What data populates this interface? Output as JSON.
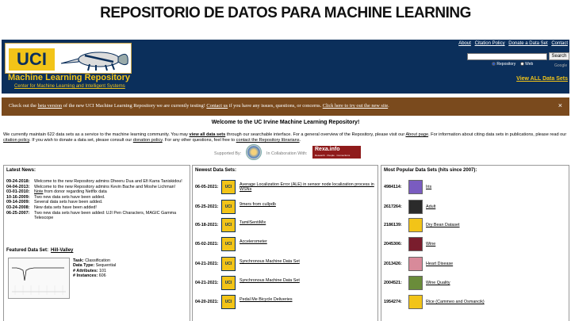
{
  "slide_title": "REPOSITORIO DE DATOS PARA MACHINE LEARNING",
  "header": {
    "logo_text": "UCI",
    "repo_name": "Machine Learning Repository",
    "repo_sub": "Center for Machine Learning and Intelligent Systems",
    "top_links": [
      "About",
      "Citation Policy",
      "Donate a Data Set",
      "Contact"
    ],
    "search": {
      "button_label": "Search",
      "value": "",
      "options": [
        "Repository",
        "Web"
      ],
      "selected": "Repository",
      "google_label": "Google"
    },
    "view_all_label": "View ALL Data Sets"
  },
  "beta_banner": {
    "text_1": "Check out the ",
    "link_1": "beta version",
    "text_2": " of the new UCI Machine Learning Repository we are currently testing! ",
    "link_2": "Contact us",
    "text_3": " if you have any issues, questions, or concerns. ",
    "link_3": "Click here to try out the new site",
    "text_4": ".",
    "close_label": "×"
  },
  "welcome_title": "Welcome to the UC Irvine Machine Learning Repository!",
  "intro": {
    "t1": "We currently maintain 622 data sets as a service to the machine learning community. You may ",
    "l1": "view all data sets",
    "t2": " through our searchable interface. For a general overview of the Repository, please visit our ",
    "l2": "About page",
    "t3": ". For information about citing data sets in publications, please read our ",
    "l3": "citation policy",
    "t4": ". If you wish to donate a data set, please consult our ",
    "l4": "donation policy",
    "t5": ". For any other questions, feel free to ",
    "l5": "contact the Repository librarians",
    "t6": "."
  },
  "supported_by": "Supported By:",
  "in_collaboration": "In Collaboration With:",
  "rexa": {
    "name": "Rexa.info",
    "tagline": "Research · People · Connections"
  },
  "latest_news": {
    "title": "Latest News:",
    "items": [
      {
        "date": "09-24-2018:",
        "text": "Welcome to the new Repository admins Dheeru Dua and Efi Karra Taniskidou!"
      },
      {
        "date": "04-04-2013:",
        "text": "Welcome to the new Repository admins Kevin Bache and Moshe Lichman!"
      },
      {
        "date": "03-01-2010:",
        "link": "Note",
        "text": " from donor regarding Netflix data"
      },
      {
        "date": "10-16-2009:",
        "text": "Two new data sets have been added."
      },
      {
        "date": "09-14-2009:",
        "text": "Several data sets have been added."
      },
      {
        "date": "03-24-2008:",
        "text": "New data sets have been added!"
      },
      {
        "date": "06-25-2007:",
        "text": "Two new data sets have been added: UJI Pen Characters, MAGIC Gamma Telescope"
      }
    ]
  },
  "featured": {
    "label": "Featured Data Set:",
    "name": "Hill-Valley",
    "task_label": "Task:",
    "task": "Classification",
    "type_label": "Data Type:",
    "type": "Sequential",
    "attr_label": "# Attributes:",
    "attributes": "101",
    "inst_label": "# Instances:",
    "instances": "606"
  },
  "newest": {
    "title": "Newest Data Sets:",
    "icon_text": "UCI",
    "items": [
      {
        "date": "06-05-2021:",
        "name": "Average Localization Error (ALE) in sensor node localization process in WSNs"
      },
      {
        "date": "05-25-2021:",
        "name": "9mers from cullpdb"
      },
      {
        "date": "05-18-2021:",
        "name": "TamilSentiMix"
      },
      {
        "date": "05-02-2021:",
        "name": "Accelerometer"
      },
      {
        "date": "04-21-2021:",
        "name": "Synchronous Machine Data Set"
      },
      {
        "date": "04-21-2021:",
        "name": "Synchronous Machine Data Set"
      },
      {
        "date": "04-20-2021:",
        "name": "Pedal Me Bicycle Deliveries"
      }
    ]
  },
  "popular": {
    "title": "Most Popular Data Sets (hits since 2007):",
    "icon_text": "UCI",
    "items": [
      {
        "hits": "4984114:",
        "name": "Iris",
        "color": "#7a5cc0"
      },
      {
        "hits": "2617264:",
        "name": "Adult",
        "color": "#2b2b2b"
      },
      {
        "hits": "2186139:",
        "name": "Dry Bean Dataset",
        "color": "#f2c418"
      },
      {
        "hits": "2045306:",
        "name": "Wine",
        "color": "#7a1d2d"
      },
      {
        "hits": "2013426:",
        "name": "Heart Disease",
        "color": "#d88a9a"
      },
      {
        "hits": "2004521:",
        "name": "Wine Quality",
        "color": "#6a8c3a"
      },
      {
        "hits": "1954274:",
        "name": "Rice (Cammeo and Osmancik)",
        "color": "#f2c418"
      }
    ]
  }
}
